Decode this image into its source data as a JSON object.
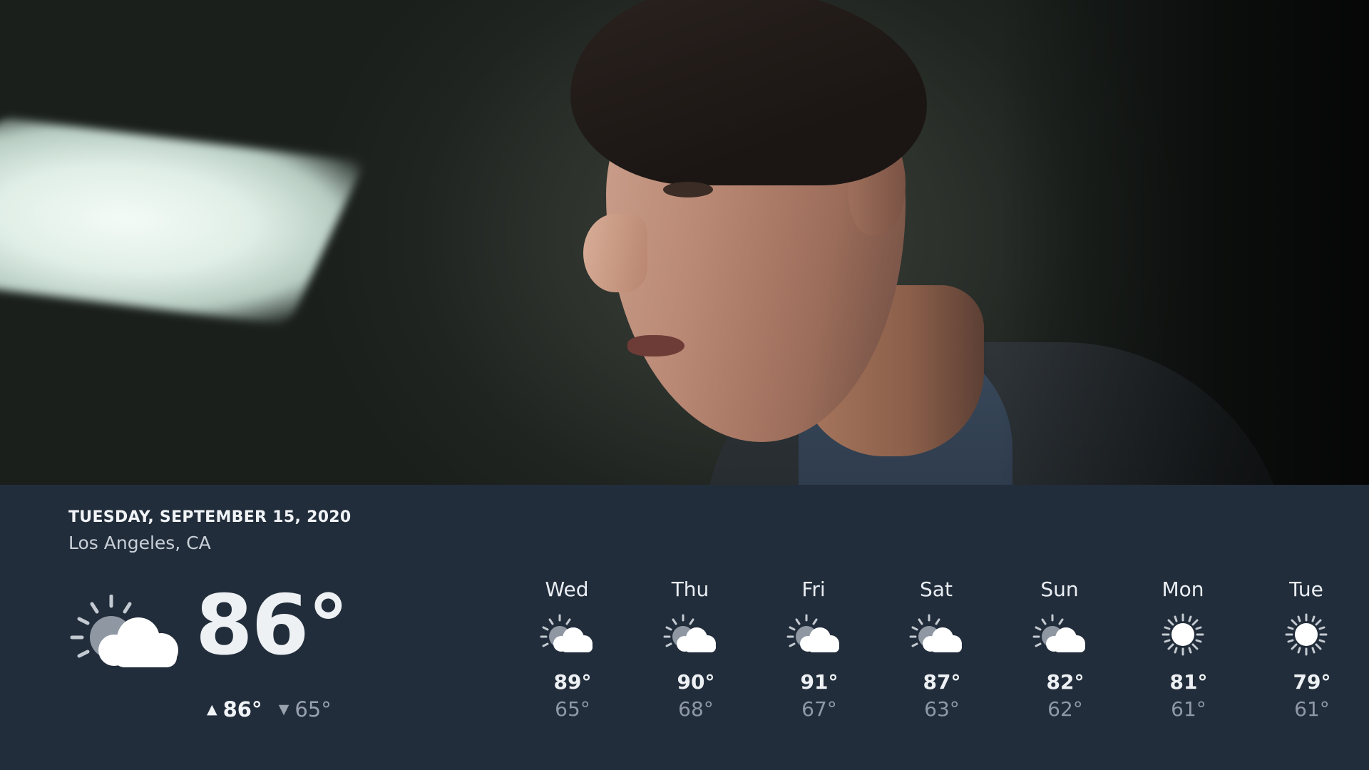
{
  "panel": {
    "date": "TUESDAY, SEPTEMBER 15, 2020",
    "location": "Los Angeles, CA"
  },
  "current": {
    "icon": "partly-cloudy-icon",
    "temperature": "86°",
    "high": "86°",
    "low": "65°"
  },
  "forecast": [
    {
      "day": "Wed",
      "icon": "partly-cloudy-icon",
      "high": "89°",
      "low": "65°"
    },
    {
      "day": "Thu",
      "icon": "partly-cloudy-icon",
      "high": "90°",
      "low": "68°"
    },
    {
      "day": "Fri",
      "icon": "partly-cloudy-icon",
      "high": "91°",
      "low": "67°"
    },
    {
      "day": "Sat",
      "icon": "partly-cloudy-icon",
      "high": "87°",
      "low": "63°"
    },
    {
      "day": "Sun",
      "icon": "partly-cloudy-icon",
      "high": "82°",
      "low": "62°"
    },
    {
      "day": "Mon",
      "icon": "sunny-icon",
      "high": "81°",
      "low": "61°"
    },
    {
      "day": "Tue",
      "icon": "sunny-icon",
      "high": "79°",
      "low": "61°"
    }
  ],
  "colors": {
    "panel_background": "#222d3b",
    "primary_text": "#eef1f4",
    "secondary_text": "#8f99a6"
  }
}
